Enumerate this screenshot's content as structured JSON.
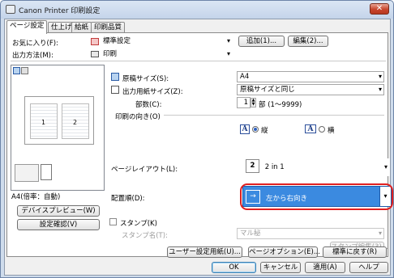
{
  "window": {
    "title": "Canon Printer 印刷設定",
    "close_label": "✕"
  },
  "tabs": [
    {
      "label": "ページ設定"
    },
    {
      "label": "仕上げ"
    },
    {
      "label": "給紙"
    },
    {
      "label": "印刷品質"
    }
  ],
  "top": {
    "favorite_label": "お気に入り(F):",
    "favorite_value": "標準設定",
    "add_button": "追加(1)...",
    "edit_button": "編集(2)...",
    "output_label": "出力方法(M):",
    "output_value": "印刷"
  },
  "preview": {
    "caption": "A4(倍率：自動)",
    "page1": "1",
    "page2": "2",
    "device_preview_button": "デバイスプレビュー(W)",
    "settings_confirm_button": "設定確認(V)"
  },
  "settings": {
    "original_size_label": "原稿サイズ(S):",
    "original_size_value": "A4",
    "output_paper_label": "出力用紙サイズ(Z):",
    "output_paper_value": "原稿サイズと同じ",
    "copies_label": "部数(C):",
    "copies_value": "1",
    "copies_range": "部 (1～9999)",
    "orientation_label": "印刷の向き(O)",
    "portrait_label": "縦",
    "landscape_label": "横",
    "page_layout_label": "ページレイアウト(L):",
    "page_layout_value": "2 in 1",
    "page_layout_icon_number": "2",
    "arrangement_label": "配置順(D):",
    "arrangement_value": "左から右向き",
    "stamp_label": "スタンプ(K)",
    "stamp_name_label": "スタンプ名(T):",
    "stamp_name_value": "マル秘",
    "stamp_edit_button": "スタンプ編集(3)..."
  },
  "bottom_panel_buttons": {
    "user_paper": "ユーザー設定用紙(U)...",
    "page_options": "ページオプション(E)...",
    "restore_defaults": "標準に戻す(R)"
  },
  "dialog_buttons": {
    "ok": "OK",
    "cancel": "キャンセル",
    "apply": "適用(A)",
    "help": "ヘルプ"
  },
  "colors": {
    "accent_select": "#3b8ae0",
    "highlight_ring": "#e02020",
    "close_button": "#c7452c"
  }
}
